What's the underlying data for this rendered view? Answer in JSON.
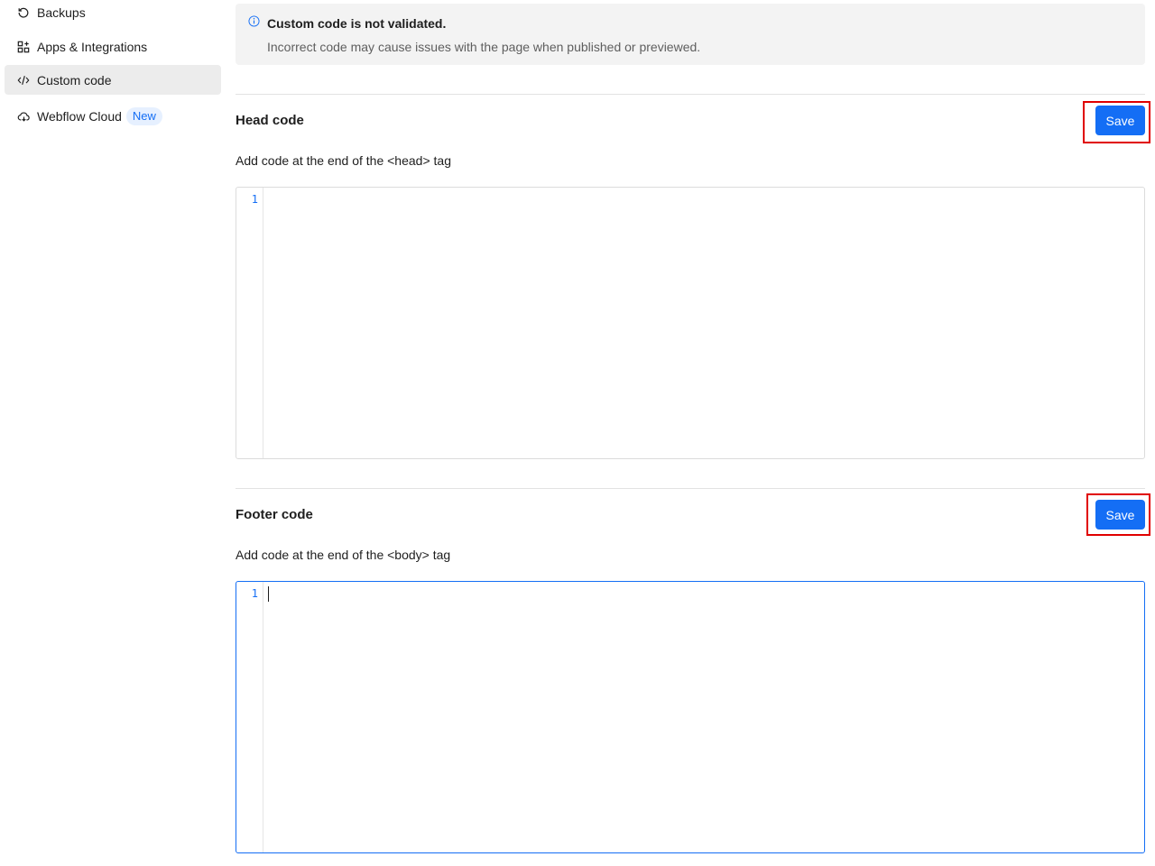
{
  "sidebar": {
    "items": [
      {
        "label": "Backups",
        "icon": "restore-icon",
        "active": false
      },
      {
        "label": "Apps & Integrations",
        "icon": "apps-grid-icon",
        "active": false
      },
      {
        "label": "Custom code",
        "icon": "code-icon",
        "active": true
      },
      {
        "label": "Webflow Cloud",
        "icon": "cloud-icon",
        "active": false,
        "badge": "New"
      }
    ]
  },
  "notice": {
    "icon": "info-icon",
    "title": "Custom code is not validated.",
    "description": "Incorrect code may cause issues with the page when published or previewed."
  },
  "head_section": {
    "title": "Head code",
    "description": "Add code at the end of the <head> tag",
    "save_label": "Save",
    "line_number": "1",
    "code": ""
  },
  "footer_section": {
    "title": "Footer code",
    "description": "Add code at the end of the <body> tag",
    "save_label": "Save",
    "line_number": "1",
    "code": ""
  },
  "colors": {
    "accent": "#146ef5",
    "highlight": "#e00000",
    "active_bg": "#ececec"
  }
}
